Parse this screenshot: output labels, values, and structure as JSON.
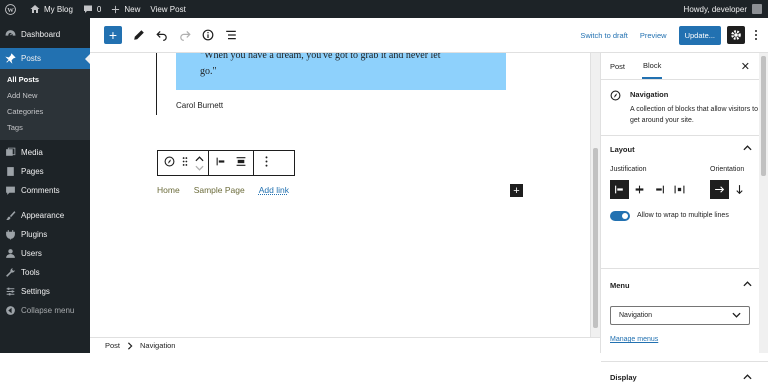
{
  "admin_bar": {
    "site_name": "My Blog",
    "comments_count": "0",
    "new_label": "New",
    "view_post_label": "View Post",
    "greeting": "Howdy, developer"
  },
  "sidebar": {
    "dashboard": "Dashboard",
    "posts": "Posts",
    "posts_sub": [
      "All Posts",
      "Add New",
      "Categories",
      "Tags"
    ],
    "media": "Media",
    "pages": "Pages",
    "comments": "Comments",
    "appearance": "Appearance",
    "plugins": "Plugins",
    "users": "Users",
    "tools": "Tools",
    "settings": "Settings",
    "collapse": "Collapse menu"
  },
  "toolbar": {
    "switch_to_draft": "Switch to draft",
    "preview": "Preview",
    "update": "Update...",
    "add_symbol": "+"
  },
  "content": {
    "quote_line1": "\"When you have a dream, you've got to grab it and never let",
    "quote_line2": "go.\"",
    "citation": "Carol Burnett",
    "nav_items": [
      "Home",
      "Sample Page",
      "Add link"
    ],
    "appender_symbol": "+"
  },
  "breadcrumb": {
    "root": "Post",
    "current": "Navigation"
  },
  "inspector": {
    "tab_post": "Post",
    "tab_block": "Block",
    "close_symbol": "✕",
    "block_title": "Navigation",
    "block_description": "A collection of blocks that allow visitors to get around your site.",
    "layout_heading": "Layout",
    "justification_label": "Justification",
    "orientation_label": "Orientation",
    "wrap_label": "Allow to wrap to multiple lines",
    "wrap_enabled": true,
    "menu_heading": "Menu",
    "menu_selected": "Navigation",
    "manage_menus": "Manage menus",
    "display_heading": "Display"
  },
  "colors": {
    "admin_dark": "#1d2327",
    "accent": "#2271b1",
    "quote_bg": "#8ed1fc",
    "nav_link": "#6b6b3a"
  }
}
